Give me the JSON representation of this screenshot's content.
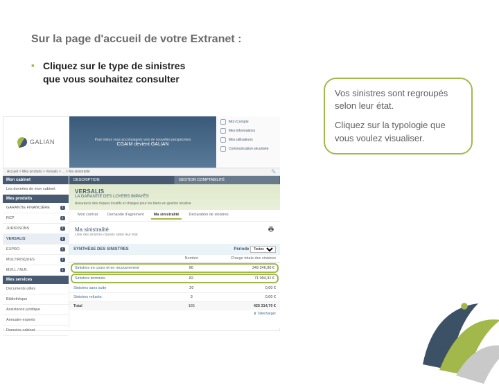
{
  "header": "Sur la page d'accueil de votre Extranet :",
  "bullet": {
    "line1": "Cliquez sur le type de sinistres",
    "line2": "que vous souhaitez consulter"
  },
  "callout": {
    "p1": "Vos sinistres sont regroupés selon leur état.",
    "p2": "Cliquez sur la typologie que vous voulez visualiser."
  },
  "mock": {
    "logo": "GALIAN",
    "hero_small": "Pour mieux vous accompagner vers de nouvelles perspectives",
    "hero_main": "CGAIM devient GALIAN",
    "profile": {
      "name": "Mon Compte",
      "items": [
        "Mes informations",
        "Mes utilisateurs",
        "Communication sécurisée"
      ]
    },
    "crumb": "Accueil > Mes produits > Versalis > ... > Ma sinistralité",
    "sidebar": {
      "h1": "Mon cabinet",
      "i1": "Les données de mon cabinet",
      "h2": "Mes produits",
      "items": [
        {
          "label": "GARANTIE FINANCIÈRE",
          "badge": ""
        },
        {
          "label": "RCP",
          "badge": ""
        },
        {
          "label": "JURIDISONS",
          "badge": ""
        },
        {
          "label": "VERSALIS",
          "badge": "",
          "sel": true
        },
        {
          "label": "EXPRO",
          "badge": ""
        },
        {
          "label": "MULTIRISQUES",
          "badge": ""
        },
        {
          "label": "M.R.I. / M.R.",
          "badge": ""
        }
      ],
      "h3": "Mes services",
      "svc": [
        "Documents utiles",
        "Bibliothèque",
        "Assistance juridique",
        "Annuaire experts",
        "Données cabinet"
      ]
    },
    "tabs": [
      "DESCRIPTION",
      "GESTION COMPTABILITÉ"
    ],
    "banner": {
      "t1": "VERSALIS",
      "t2": "LA GARANTIE DES LOYERS IMPAYÉS"
    },
    "banner_under": "Assurance des risques locatifs et charges pour les biens en gestion locative",
    "subtabs": [
      "Mon contrat",
      "Demande d'agrément",
      "Ma sinistralité",
      "Déclaration de sinistres"
    ],
    "section_title": "Ma sinistralité",
    "section_sub": "Liste des sinistres classés selon leur état",
    "synth": "SYNTHÈSE DES SINISTRES",
    "period_label": "Période",
    "period_value": "Toutes",
    "thead": {
      "c1": "",
      "c2": "Nombre",
      "c3": "Charge totale des sinistres"
    },
    "rows": [
      {
        "label": "Sinistres en cours et en recouvrement",
        "n": "80",
        "v": "349 246,90 €",
        "hl": true
      },
      {
        "label": "Sinistres terminés",
        "n": "82",
        "v": "71 094,31 €",
        "hl": true
      },
      {
        "label": "Sinistres sans suite",
        "n": "20",
        "v": "0,00 €"
      },
      {
        "label": "Sinistres refusés",
        "n": "3",
        "v": "0,00 €"
      }
    ],
    "total": {
      "label": "Total",
      "n": "185",
      "v": "425 314,70 €"
    },
    "foot": "Télécharger"
  }
}
